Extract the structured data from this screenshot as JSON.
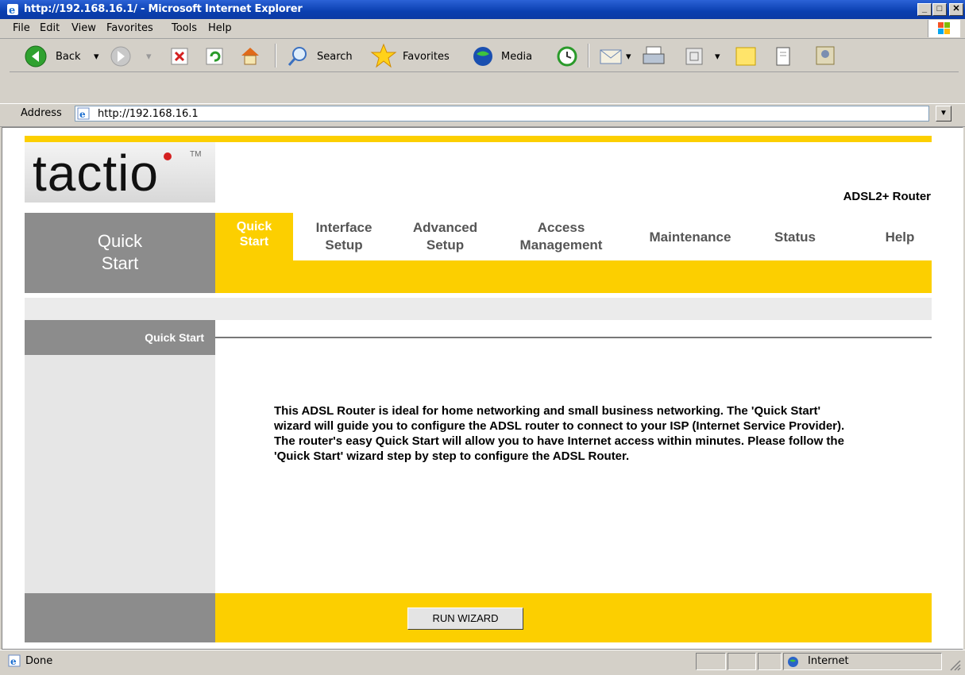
{
  "window": {
    "title": "http://192.168.16.1/ - Microsoft Internet Explorer",
    "buttons": {
      "minimize": "_",
      "maximize": "□",
      "close": "✕"
    }
  },
  "menubar": [
    "File",
    "Edit",
    "View",
    "Favorites",
    "Tools",
    "Help"
  ],
  "toolbar": {
    "back": "Back",
    "search": "Search",
    "favorites": "Favorites",
    "media": "Media"
  },
  "address": {
    "label": "Address",
    "url": "http://192.168.16.1"
  },
  "page": {
    "logo": {
      "text": "tactio",
      "tm": "TM"
    },
    "product": "ADSL2+ Router",
    "section_title": "Quick Start",
    "nav": [
      {
        "line1": "Quick",
        "line2": "Start"
      },
      {
        "line1": "Interface",
        "line2": "Setup"
      },
      {
        "line1": "Advanced",
        "line2": "Setup"
      },
      {
        "line1": "Access",
        "line2": "Management"
      },
      {
        "line1": "Maintenance",
        "line2": ""
      },
      {
        "line1": "Status",
        "line2": ""
      },
      {
        "line1": "Help",
        "line2": ""
      }
    ],
    "side_label": "Quick Start",
    "description": "This ADSL Router is ideal for home networking and small business networking. The 'Quick Start' wizard will guide you to configure the ADSL router to connect to your ISP (Internet Service Provider). The router's easy Quick Start will allow you to have Internet access within minutes. Please follow the 'Quick Start' wizard step by step to configure the ADSL Router.",
    "wizard_button": "RUN WIZARD"
  },
  "status": {
    "text": "Done",
    "zone": "Internet"
  },
  "colors": {
    "accent_yellow": "#fccf00",
    "panel_gray": "#8c8c8c",
    "side_gray": "#e6e6e6"
  }
}
